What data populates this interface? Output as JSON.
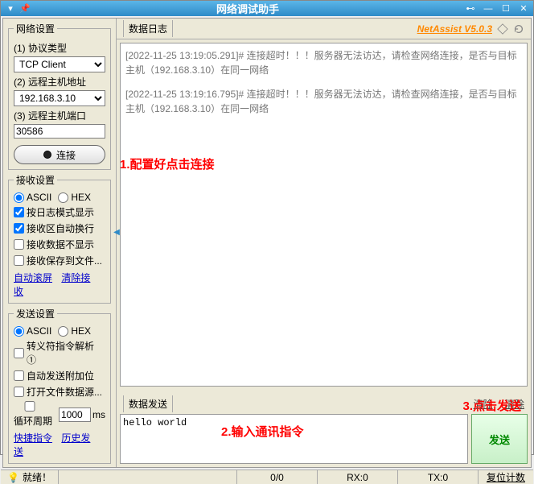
{
  "window": {
    "title": "网络调试助手"
  },
  "brand": "NetAssist V5.0.3",
  "panels": {
    "network": {
      "legend": "网络设置",
      "protocol_label": "(1) 协议类型",
      "protocol_value": "TCP Client",
      "host_label": "(2) 远程主机地址",
      "host_value": "192.168.3.10",
      "port_label": "(3) 远程主机端口",
      "port_value": "30586",
      "connect_label": "连接"
    },
    "recv": {
      "legend": "接收设置",
      "radio_ascii": "ASCII",
      "radio_hex": "HEX",
      "check1": "按日志模式显示",
      "check2": "接收区自动换行",
      "check3": "接收数据不显示",
      "check4": "接收保存到文件...",
      "link1": "自动滚屏",
      "link2": "清除接收"
    },
    "send": {
      "legend": "发送设置",
      "radio_ascii": "ASCII",
      "radio_hex": "HEX",
      "check1": "转义符指令解析 ①",
      "check2": "自动发送附加位",
      "check3": "打开文件数据源...",
      "cycle_label1": "循环周期",
      "cycle_value": "1000",
      "cycle_unit": "ms",
      "link1": "快捷指令",
      "link2": "历史发送"
    }
  },
  "log": {
    "header": "数据日志",
    "entries": [
      "[2022-11-25 13:19:05.291]# 连接超时！！！服务器无法访达，请检查网络连接，是否与目标主机（192.168.3.10）在同一网络",
      "[2022-11-25 13:19:16.795]# 连接超时！！！服务器无法访达，请检查网络连接，是否与目标主机（192.168.3.10）在同一网络"
    ]
  },
  "sendbox": {
    "header": "数据发送",
    "clear1": "清除",
    "clear2": "清除",
    "input_value": "hello world",
    "send_btn": "发送"
  },
  "status": {
    "ready": "就绪！",
    "cell1": "0/0",
    "cell2": "RX:0",
    "cell3": "TX:0",
    "reset": "复位计数"
  },
  "annotations": {
    "a1": "1.配置好点击连接",
    "a2": "2.输入通讯指令",
    "a3": "3.点击发送"
  }
}
